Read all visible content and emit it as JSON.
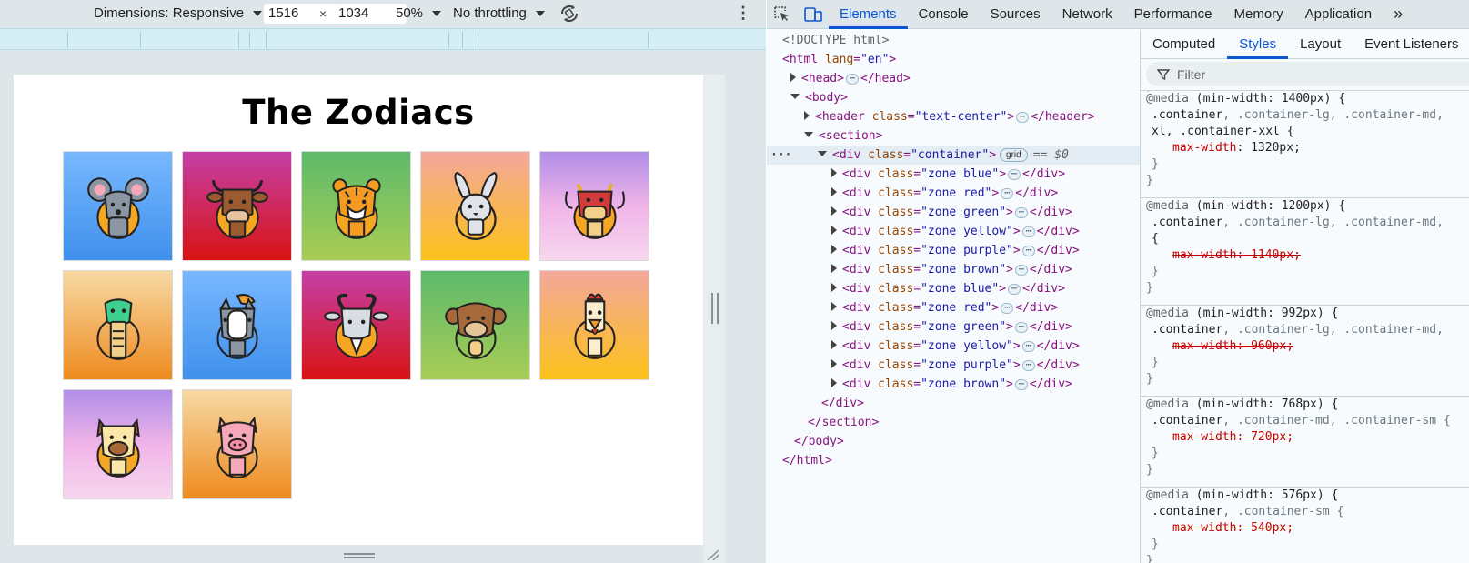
{
  "device_toolbar": {
    "dimensions_label": "Dimensions: Responsive",
    "width": "1516",
    "times": "×",
    "height": "1034",
    "zoom": "50%",
    "throttling": "No throttling"
  },
  "page": {
    "title": "The Zodiacs",
    "zones": [
      {
        "color": "blue",
        "animal": "rat"
      },
      {
        "color": "red",
        "animal": "ox"
      },
      {
        "color": "green",
        "animal": "tiger"
      },
      {
        "color": "yellow",
        "animal": "rabbit"
      },
      {
        "color": "purple",
        "animal": "dragon"
      },
      {
        "color": "brown",
        "animal": "snake"
      },
      {
        "color": "blue",
        "animal": "horse"
      },
      {
        "color": "red",
        "animal": "goat"
      },
      {
        "color": "green",
        "animal": "monkey"
      },
      {
        "color": "yellow",
        "animal": "rooster"
      },
      {
        "color": "purple",
        "animal": "dog"
      },
      {
        "color": "brown",
        "animal": "pig"
      }
    ]
  },
  "devtools": {
    "tabs": [
      "Elements",
      "Console",
      "Sources",
      "Network",
      "Performance",
      "Memory",
      "Application"
    ],
    "active_tab": "Elements",
    "more": "»",
    "elements": {
      "doctype": "<!DOCTYPE html>",
      "html_tag": "html",
      "html_attr": "lang",
      "html_attr_val": "\"en\"",
      "head": "head",
      "body": "body",
      "header": "header",
      "header_class": "\"text-center\"",
      "section": "section",
      "container_class": "\"container\"",
      "grid_badge": "grid",
      "eq_dollar": "== $0",
      "div": "div",
      "class_attr": "class",
      "ellipsis": "⋯",
      "zone_classes": [
        "\"zone blue\"",
        "\"zone red\"",
        "\"zone green\"",
        "\"zone yellow\"",
        "\"zone purple\"",
        "\"zone brown\"",
        "\"zone blue\"",
        "\"zone red\"",
        "\"zone green\"",
        "\"zone yellow\"",
        "\"zone purple\"",
        "\"zone brown\""
      ]
    },
    "styles": {
      "subtabs": [
        "Computed",
        "Styles",
        "Layout",
        "Event Listeners"
      ],
      "active_subtab": "Styles",
      "filter_placeholder": "Filter",
      "rules": [
        {
          "query": "(min-width: 1400px) {",
          "selector_main": ".container",
          "selector_rest": ", .container-lg, .container-md,",
          "selector_cont": "xl, .container-xxl {",
          "prop": "max-width",
          "value": "1320px;",
          "struck": false
        },
        {
          "query": "(min-width: 1200px) {",
          "selector_main": ".container",
          "selector_rest": ", .container-lg, .container-md,",
          "selector_cont": "{",
          "prop": "max-width",
          "value": "1140px;",
          "struck": true
        },
        {
          "query": "(min-width: 992px) {",
          "selector_main": ".container",
          "selector_rest": ", .container-lg, .container-md,",
          "selector_cont": "",
          "prop": "max-width",
          "value": "960px;",
          "struck": true
        },
        {
          "query": "(min-width: 768px) {",
          "selector_main": ".container",
          "selector_rest": ", .container-md, .container-sm {",
          "selector_cont": "",
          "prop": "max-width",
          "value": "720px;",
          "struck": true
        },
        {
          "query": "(min-width: 576px) {",
          "selector_main": ".container",
          "selector_rest": ", .container-sm {",
          "selector_cont": "",
          "prop": "max-width",
          "value": "540px;",
          "struck": true
        }
      ],
      "at_media": "@media",
      "colon": ":",
      "close_brace": "}"
    }
  }
}
